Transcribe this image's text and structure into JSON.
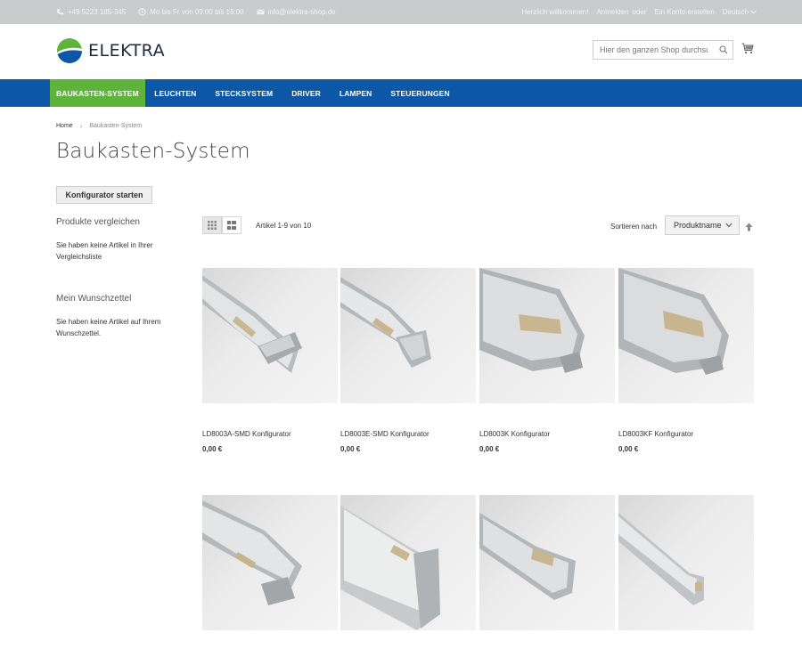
{
  "topbar": {
    "phone": "+49 5223 185-345",
    "hours": "Mo bis Fr von 09:00 bis 16:00",
    "email": "info@elektra-shop.de",
    "welcome": "Herzlich willkommen!",
    "login": "Anmelden",
    "or": "oder",
    "register": "Ein Konto erstellen",
    "language": "Deutsch"
  },
  "header": {
    "logo_text": "ELEKTRA",
    "search_placeholder": "Hier den ganzen Shop durchsuchen..."
  },
  "nav": {
    "items": [
      {
        "label": "BAUKASTEN-SYSTEM"
      },
      {
        "label": "LEUCHTEN"
      },
      {
        "label": "STECKSYSTEM"
      },
      {
        "label": "DRIVER"
      },
      {
        "label": "LAMPEN"
      },
      {
        "label": "STEUERUNGEN"
      }
    ]
  },
  "breadcrumb": {
    "home": "Home",
    "separator": "›",
    "current": "Baukasten-System"
  },
  "page": {
    "title": "Baukasten-System",
    "config_button": "Konfigurator starten"
  },
  "sidebar": {
    "compare_title": "Produkte vergleichen",
    "compare_text": "Sie haben keine Artikel in Ihrer Vergleichsliste",
    "wishlist_title": "Mein Wunschzettel",
    "wishlist_text": "Sie haben keine Artikel auf Ihrem Wunschzettel."
  },
  "toolbar": {
    "amount": "Artikel 1-9 von 10",
    "sort_label": "Sortieren nach",
    "sort_value": "Produktname"
  },
  "products": [
    {
      "name": "LD8003A-SMD Konfigurator",
      "price": "0,00 €"
    },
    {
      "name": "LD8003E-SMD Konfigurator",
      "price": "0,00 €"
    },
    {
      "name": "LD8003K Konfigurator",
      "price": "0,00 €"
    },
    {
      "name": "LD8003KF Konfigurator",
      "price": "0,00 €"
    }
  ],
  "colors": {
    "topbar": "#c9cbcc",
    "nav": "#0c58a6",
    "nav_active": "#5eb43a",
    "logo_green": "#5eb43a",
    "logo_blue": "#0c58a6"
  }
}
